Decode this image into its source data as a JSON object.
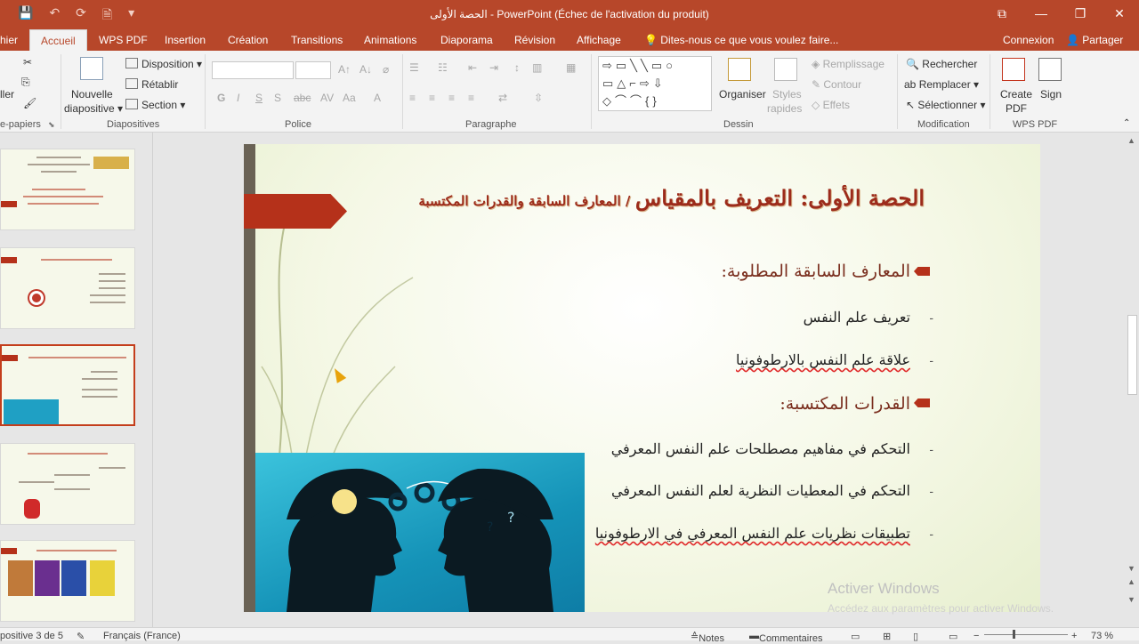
{
  "titlebar": {
    "title": "الحصة الأولى - PowerPoint (Échec de l'activation du produit)",
    "qat": [
      "💾",
      "↶",
      "⟳",
      "🗎",
      "▾"
    ],
    "controls": [
      "⧉",
      "—",
      "❐",
      "✕"
    ]
  },
  "tabs": {
    "file": "hier",
    "items": [
      "Accueil",
      "WPS PDF",
      "Insertion",
      "Création",
      "Transitions",
      "Animations",
      "Diaporama",
      "Révision",
      "Affichage"
    ],
    "tellme": "Dites-nous ce que vous voulez faire...",
    "connexion": "Connexion",
    "partager": "Partager"
  },
  "ribbon": {
    "clipboard": {
      "label": "e-papiers",
      "coller": "ller"
    },
    "slides": {
      "label": "Diapositives",
      "nouvelle": "Nouvelle",
      "diapositive": "diapositive",
      "disposition": "Disposition",
      "retablir": "Rétablir",
      "section": "Section"
    },
    "font": {
      "label": "Police",
      "bold": "G",
      "italic": "I",
      "underline": "S",
      "strike": "S"
    },
    "paragraph": {
      "label": "Paragraphe"
    },
    "drawing": {
      "label": "Dessin",
      "organiser": "Organiser",
      "styles": "Styles",
      "rapides": "rapides",
      "remplissage": "Remplissage",
      "contour": "Contour",
      "effets": "Effets"
    },
    "editing": {
      "label": "Modification",
      "rechercher": "Rechercher",
      "remplacer": "Remplacer",
      "selectionner": "Sélectionner"
    },
    "wps": {
      "label": "WPS PDF",
      "create": "Create",
      "pdf": "PDF",
      "sign": "Sign"
    }
  },
  "slide": {
    "title_main": "الحصة الأولى: التعريف بالمقياس",
    "title_sub": "/ المعارف السابقة والقدرات المكتسبة",
    "heading1": "المعارف السابقة المطلوبة:",
    "items1": [
      "تعريف علم النفس",
      "علاقة علم النفس بالارطوفونيا"
    ],
    "heading2": "القدرات المكتسبة:",
    "items2": [
      "التحكم في مفاهيم مصطلحات علم النفس المعرفي",
      "التحكم في المعطيات النظرية لعلم النفس المعرفي",
      "تطبيقات نظريات علم النفس المعرفي في الارطوفونيا"
    ],
    "dash": "-"
  },
  "watermark": {
    "line1": "Activer Windows",
    "line2": "Accédez aux paramètres pour activer Windows."
  },
  "statusbar": {
    "slide": "positive 3 de 5",
    "language": "Français (France)",
    "notes": "Notes",
    "comments": "Commentaires",
    "zoom": "73 %"
  },
  "colors": {
    "accent": "#b7472a",
    "slide_red": "#b5311a",
    "title_text": "#9c2b1b"
  }
}
